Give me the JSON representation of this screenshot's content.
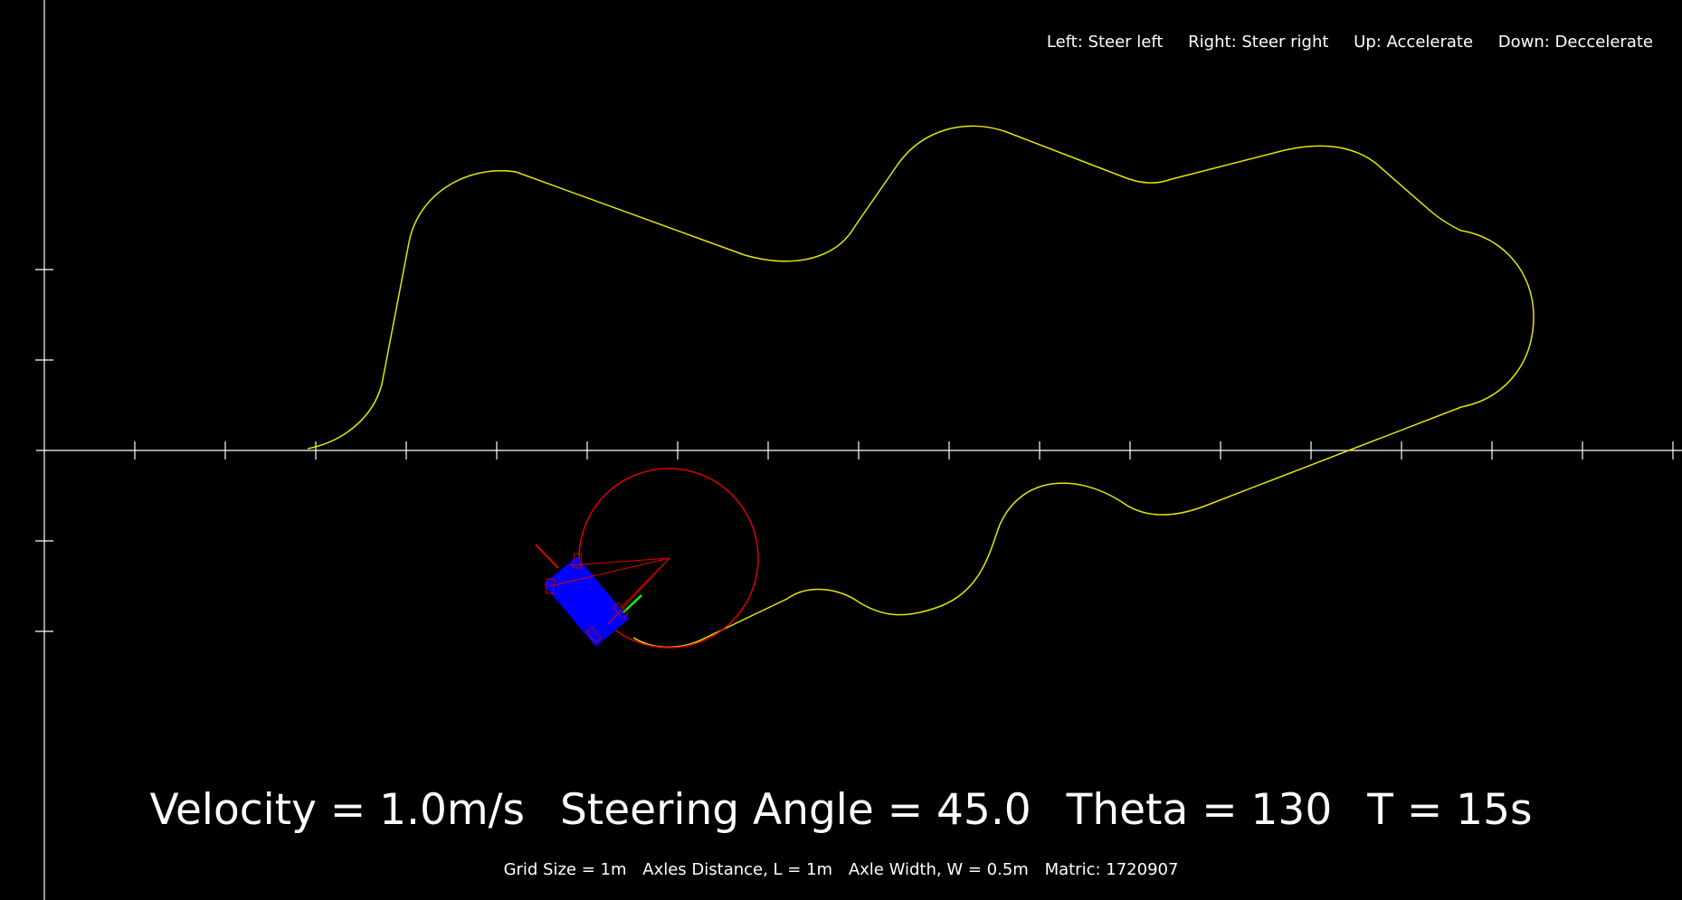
{
  "controls": {
    "left": "Left: Steer left",
    "right": "Right: Steer right",
    "up": "Up: Accelerate",
    "down": "Down: Deccelerate"
  },
  "status": {
    "velocity": "Velocity = 1.0m/s",
    "steering": "Steering Angle = 45.0",
    "theta": "Theta = 130",
    "time": "T = 15s"
  },
  "params": {
    "grid": "Grid Size = 1m",
    "axles_distance": "Axles Distance, L = 1m",
    "axle_width": "Axle Width, W = 0.5m",
    "matric": "Matric: 1720907"
  },
  "colors": {
    "background": "#000000",
    "axes": "#ffffff",
    "track": "#e6e600",
    "turning_circle": "#e00000",
    "car_body": "#0000ff",
    "heading_vector": "#00ff00"
  }
}
